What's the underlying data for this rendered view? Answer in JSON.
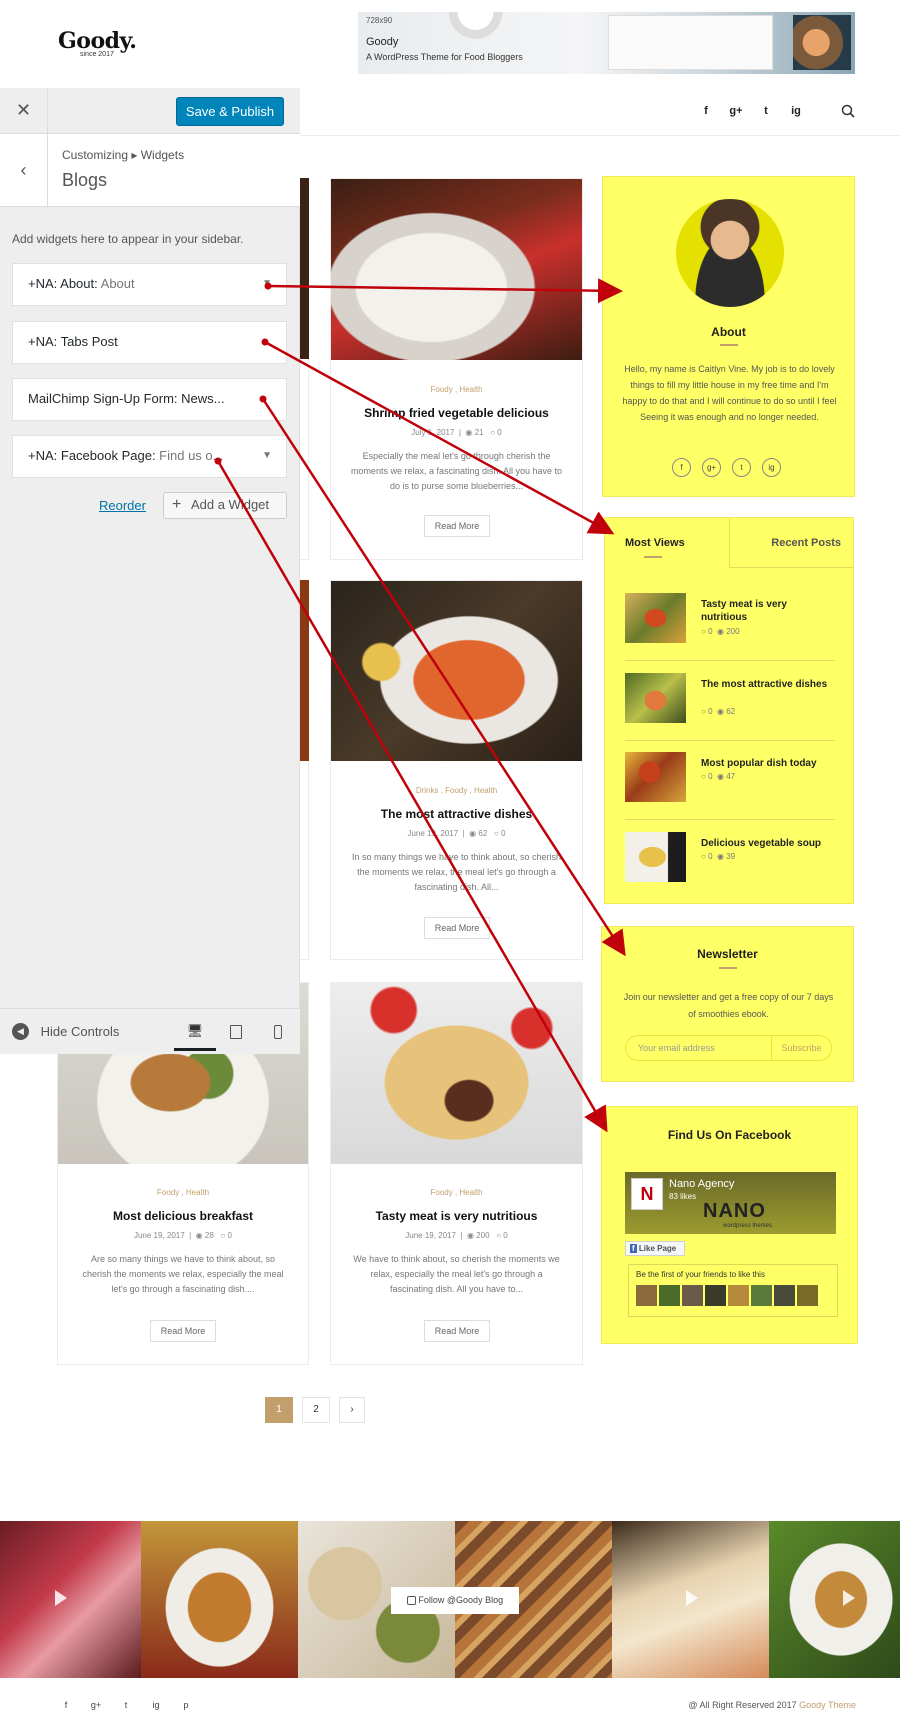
{
  "header": {
    "logo": "Goody.",
    "logo_sub": "since 2017",
    "ad_size": "728x90",
    "ad_title": "Goody",
    "ad_subtitle": "A WordPress Theme for Food Bloggers",
    "nav_icons": [
      "f",
      "g+",
      "t",
      "ig"
    ]
  },
  "customizer": {
    "publish_label": "Save & Publish",
    "breadcrumb": "Customizing ▸ Widgets",
    "section_title": "Blogs",
    "description": "Add widgets here to appear in your sidebar.",
    "widgets": [
      {
        "prefix": "+NA: About:",
        "name": " About"
      },
      {
        "prefix": "+NA: Tabs Post",
        "name": ""
      },
      {
        "prefix": "MailChimp Sign-Up Form: News...",
        "name": ""
      },
      {
        "prefix": "+NA: Facebook Page:",
        "name": " Find us o..."
      }
    ],
    "reorder_label": "Reorder",
    "add_widget_label": "Add a Widget",
    "hide_controls_label": "Hide Controls"
  },
  "posts": [
    {
      "cats": "Foody ,  Health",
      "title": "Shrimp fried vegetable delicious",
      "date": "July 1, 2017",
      "views": "21",
      "comments": "0",
      "excerpt": "Especially the meal let's go through cherish the moments we relax, a fascinating dish. All you have to do is to purse some blueberries...",
      "read_more": "Read More"
    },
    {
      "cats": "Drinks ,  Foody ,  Health",
      "title": "The most attractive dishes",
      "date": "June 19, 2017",
      "views": "62",
      "comments": "0",
      "excerpt": "In so many things we have to think about, so cherish the moments we relax, the meal let's go through a fascinating dish. All...",
      "read_more": "Read More"
    },
    {
      "cats": "Foody ,  Health",
      "title": "Most delicious breakfast",
      "date": "June 19, 2017",
      "views": "28",
      "comments": "0",
      "excerpt": "Are so many things we have to think about, so cherish the moments we relax, especially the meal let's go through a fascinating dish....",
      "read_more": "Read More"
    },
    {
      "cats": "Foody ,  Health",
      "title": "Tasty meat is very nutritious",
      "date": "June 19, 2017",
      "views": "200",
      "comments": "0",
      "excerpt": "We have to think about, so cherish the moments we relax, especially the meal let's go through a fascinating dish. All you have to...",
      "read_more": "Read More"
    }
  ],
  "about": {
    "title": "About",
    "text": "Hello, my name is Caitlyn Vine. My job is to do lovely things to fill my little house in my free time and I'm happy to do that and I will continue to do so until I feel Seeing it was enough and no longer needed.",
    "icons": [
      "f",
      "g+",
      "t",
      "ig"
    ]
  },
  "tabs": {
    "tab1": "Most Views",
    "tab2": "Recent Posts",
    "items": [
      {
        "title": "Tasty meat is very nutritious",
        "comments": "0",
        "views": "200"
      },
      {
        "title": "The most attractive dishes",
        "comments": "0",
        "views": "62"
      },
      {
        "title": "Most popular dish today",
        "comments": "0",
        "views": "47"
      },
      {
        "title": "Delicious vegetable soup",
        "comments": "0",
        "views": "39"
      }
    ]
  },
  "newsletter": {
    "title": "Newsletter",
    "text": "Join our newsletter and get a free copy of our 7 days of smoothies ebook.",
    "placeholder": "Your email address",
    "button": "Subscribe"
  },
  "facebook": {
    "title": "Find Us On Facebook",
    "page_name": "Nano Agency",
    "likes": "83 likes",
    "brand": "NANO",
    "brand_sub": "wordpress themes",
    "like_button": "Like Page",
    "friends_text": "Be the first of your friends to like this"
  },
  "pagination": [
    "1",
    "2",
    "›"
  ],
  "instagram": {
    "follow_label": "Follow @Goody Blog"
  },
  "footer": {
    "icons": [
      "f",
      "g+",
      "t",
      "ig",
      "p"
    ],
    "copyright": "@ All Right Reserved 2017 ",
    "brand": "Goody Theme"
  },
  "colors": {
    "accent": "#c29f6b",
    "highlight": "#ffff66",
    "publish": "#0085ba",
    "arrow": "#c0000a"
  }
}
